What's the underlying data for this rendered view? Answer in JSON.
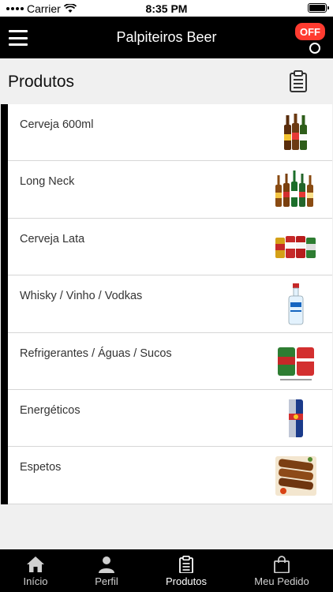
{
  "status_bar": {
    "carrier": "Carrier",
    "time": "8:35 PM"
  },
  "topnav": {
    "title": "Palpiteiros Beer",
    "badge": "OFF"
  },
  "page": {
    "title": "Produtos"
  },
  "products": [
    {
      "label": "Cerveja 600ml",
      "icon": "beer-bottles-icon"
    },
    {
      "label": "Long Neck",
      "icon": "long-neck-bottles-icon"
    },
    {
      "label": "Cerveja Lata",
      "icon": "beer-cans-icon"
    },
    {
      "label": "Whisky / Vinho / Vodkas",
      "icon": "vodka-bottle-icon"
    },
    {
      "label": "Refrigerantes / Águas / Sucos",
      "icon": "soda-cans-icon"
    },
    {
      "label": "Energéticos",
      "icon": "energy-drink-can-icon"
    },
    {
      "label": "Espetos",
      "icon": "skewers-icon"
    }
  ],
  "tabs": [
    {
      "label": "Início",
      "icon": "home-icon",
      "active": false
    },
    {
      "label": "Perfil",
      "icon": "person-icon",
      "active": false
    },
    {
      "label": "Produtos",
      "icon": "clipboard-icon",
      "active": true
    },
    {
      "label": "Meu Pedido",
      "icon": "shopping-bag-icon",
      "active": false
    }
  ],
  "colors": {
    "accent": "#000000",
    "badge": "#ff3b30",
    "background": "#f0f0f0"
  }
}
